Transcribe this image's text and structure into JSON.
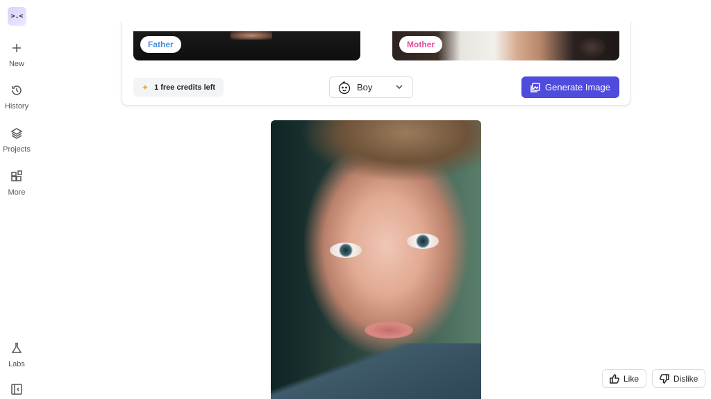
{
  "sidebar": {
    "logo": ">.<",
    "items": [
      {
        "label": "New",
        "icon": "plus-icon"
      },
      {
        "label": "History",
        "icon": "history-icon"
      },
      {
        "label": "Projects",
        "icon": "layers-icon"
      },
      {
        "label": "More",
        "icon": "grid-plus-icon"
      },
      {
        "label": "Labs",
        "icon": "flask-icon"
      }
    ],
    "collapse_icon": "sidebar-collapse-icon"
  },
  "inputs": {
    "father_label": "Father",
    "mother_label": "Mother"
  },
  "controls": {
    "credits_text": "1 free credits left",
    "gender_selected": "Boy",
    "generate_label": "Generate Image"
  },
  "feedback": {
    "like_label": "Like",
    "dislike_label": "Dislike"
  },
  "colors": {
    "accent": "#4f4bdc",
    "father_tag": "#4a8de0",
    "mother_tag": "#e0509a"
  }
}
